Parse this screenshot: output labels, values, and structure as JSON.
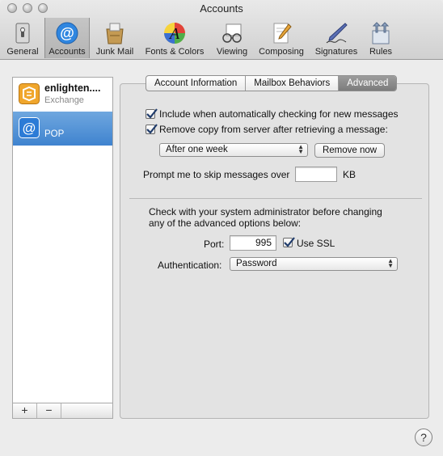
{
  "window": {
    "title": "Accounts"
  },
  "toolbar": {
    "items": [
      {
        "label": "General",
        "icon": "general-switch-icon"
      },
      {
        "label": "Accounts",
        "icon": "at-sign-icon"
      },
      {
        "label": "Junk Mail",
        "icon": "junk-bin-icon"
      },
      {
        "label": "Fonts & Colors",
        "icon": "fonts-colors-icon"
      },
      {
        "label": "Viewing",
        "icon": "viewing-glasses-icon"
      },
      {
        "label": "Composing",
        "icon": "composing-pencil-icon"
      },
      {
        "label": "Signatures",
        "icon": "signature-pen-icon"
      },
      {
        "label": "Rules",
        "icon": "rules-arrows-icon"
      }
    ],
    "selected": "Accounts"
  },
  "accounts": [
    {
      "name": "enlighten....",
      "type": "Exchange",
      "icon": "exchange-icon"
    },
    {
      "name": "POP",
      "type": "",
      "icon": "at-sign-icon"
    }
  ],
  "list_buttons": {
    "add": "+",
    "remove": "−"
  },
  "tabs": [
    "Account Information",
    "Mailbox Behaviors",
    "Advanced"
  ],
  "active_tab": "Advanced",
  "advanced": {
    "include_auto_check_label": "Include when automatically checking for new messages",
    "include_auto_check": true,
    "remove_copy_label": "Remove copy from server after retrieving a message:",
    "remove_copy": true,
    "remove_after_value": "After one week",
    "remove_now_label": "Remove now",
    "prompt_skip_label": "Prompt me to skip messages over",
    "prompt_skip_value": "",
    "prompt_skip_unit": "KB",
    "admin_note_line1": "Check with your system administrator before changing",
    "admin_note_line2": "any of the advanced options below:",
    "port_label": "Port:",
    "port_value": "995",
    "use_ssl_label": "Use SSL",
    "use_ssl": true,
    "auth_label": "Authentication:",
    "auth_value": "Password"
  },
  "help_label": "?",
  "colors": {
    "selection": "#3f83cf",
    "check": "#1f3b6b"
  }
}
